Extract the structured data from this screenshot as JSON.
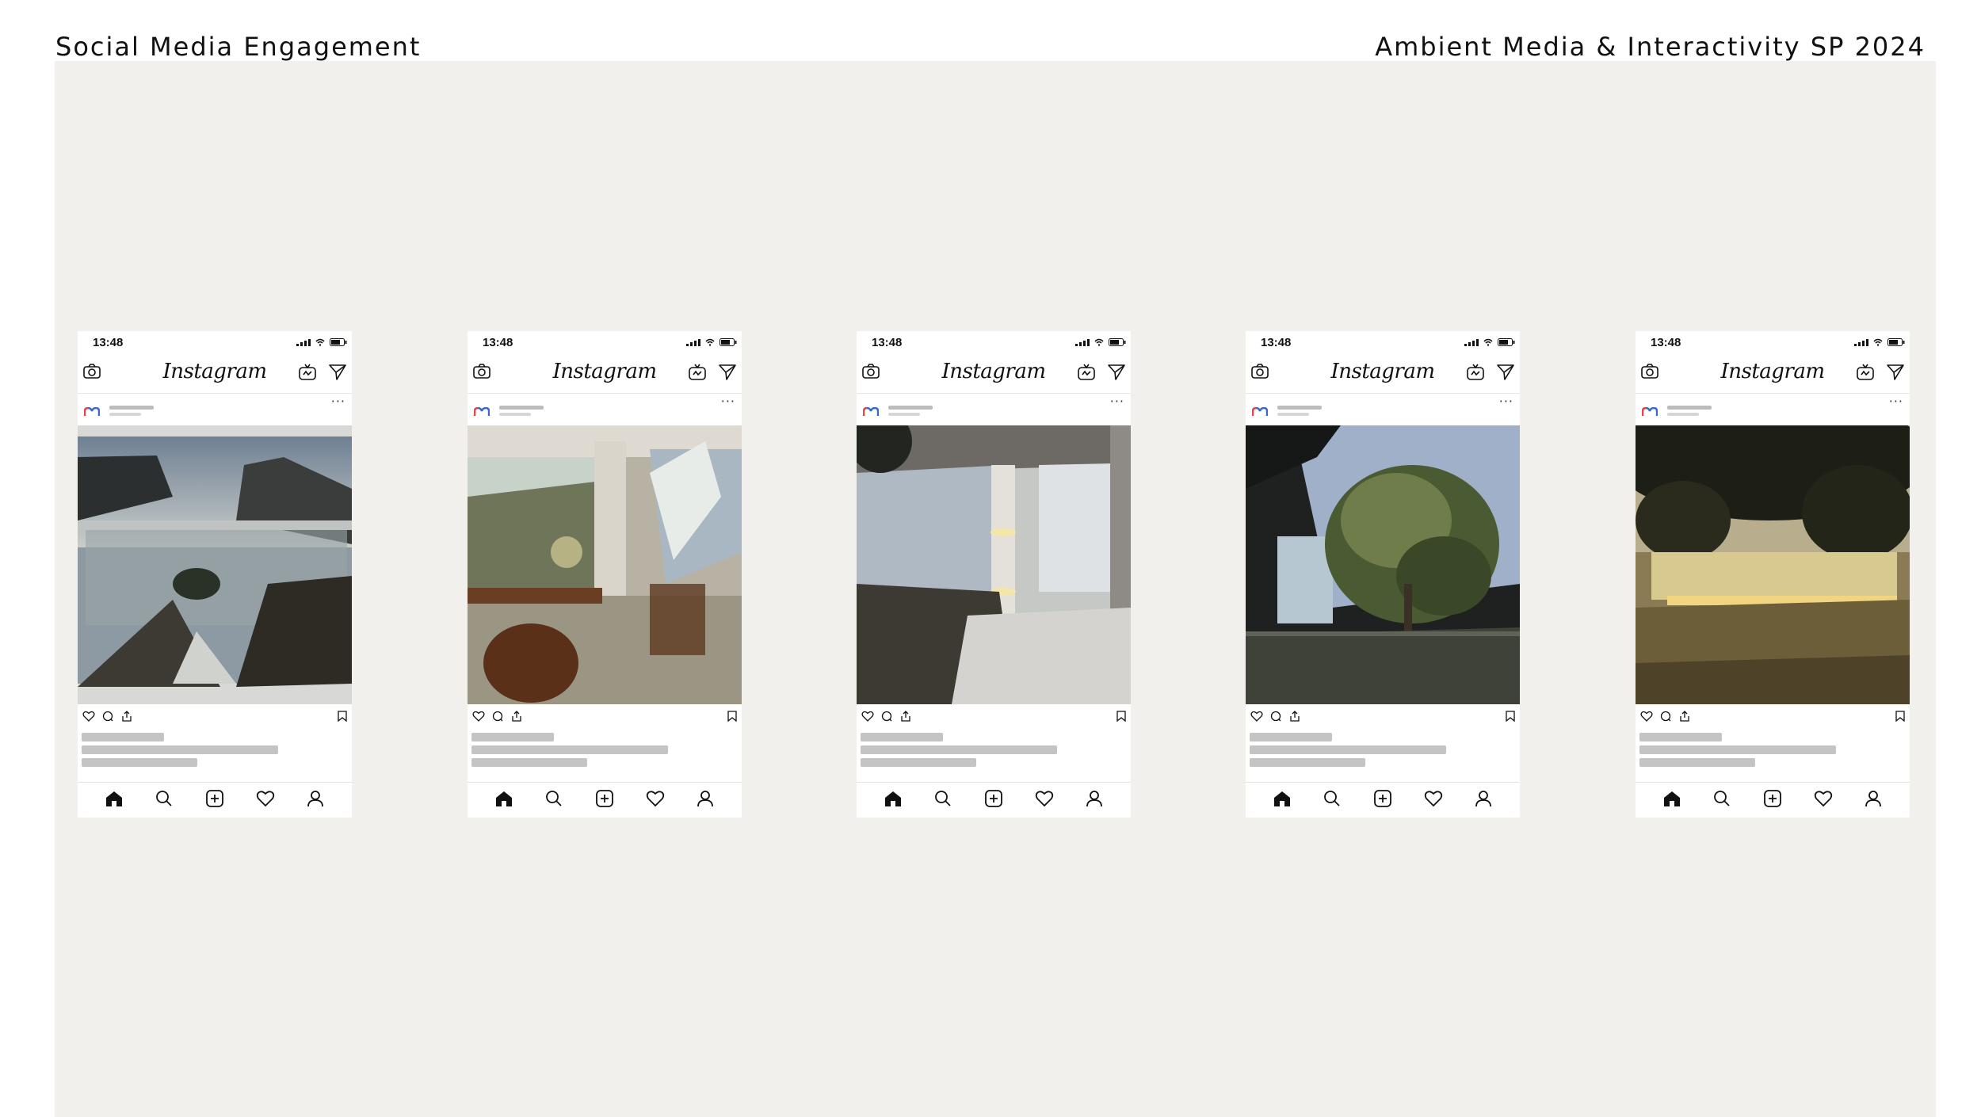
{
  "header": {
    "left_title": "Social Media Engagement",
    "right_title": "Ambient Media & Interactivity SP 2024"
  },
  "colors": {
    "board_background": "#f1f0ed",
    "placeholder_gray": "#c4c4c4",
    "accent_avatar_red": "#e0484b",
    "accent_avatar_blue": "#3b68c9"
  },
  "app": {
    "status_time": "13:48",
    "logo": "Instagram",
    "more_label": "···"
  },
  "icons": {
    "camera": "camera-icon",
    "igtv": "igtv-icon",
    "direct": "direct-message-icon",
    "like": "heart-icon",
    "comment": "comment-icon",
    "share": "share-icon",
    "save": "bookmark-icon",
    "home": "home-icon",
    "search": "search-icon",
    "add": "add-post-icon",
    "activity": "heart-icon",
    "profile": "profile-icon"
  },
  "posts": [
    {
      "scene": "courtyard-rocks"
    },
    {
      "scene": "dining-room"
    },
    {
      "scene": "corridor-column"
    },
    {
      "scene": "tree-atrium"
    },
    {
      "scene": "night-garden"
    }
  ]
}
